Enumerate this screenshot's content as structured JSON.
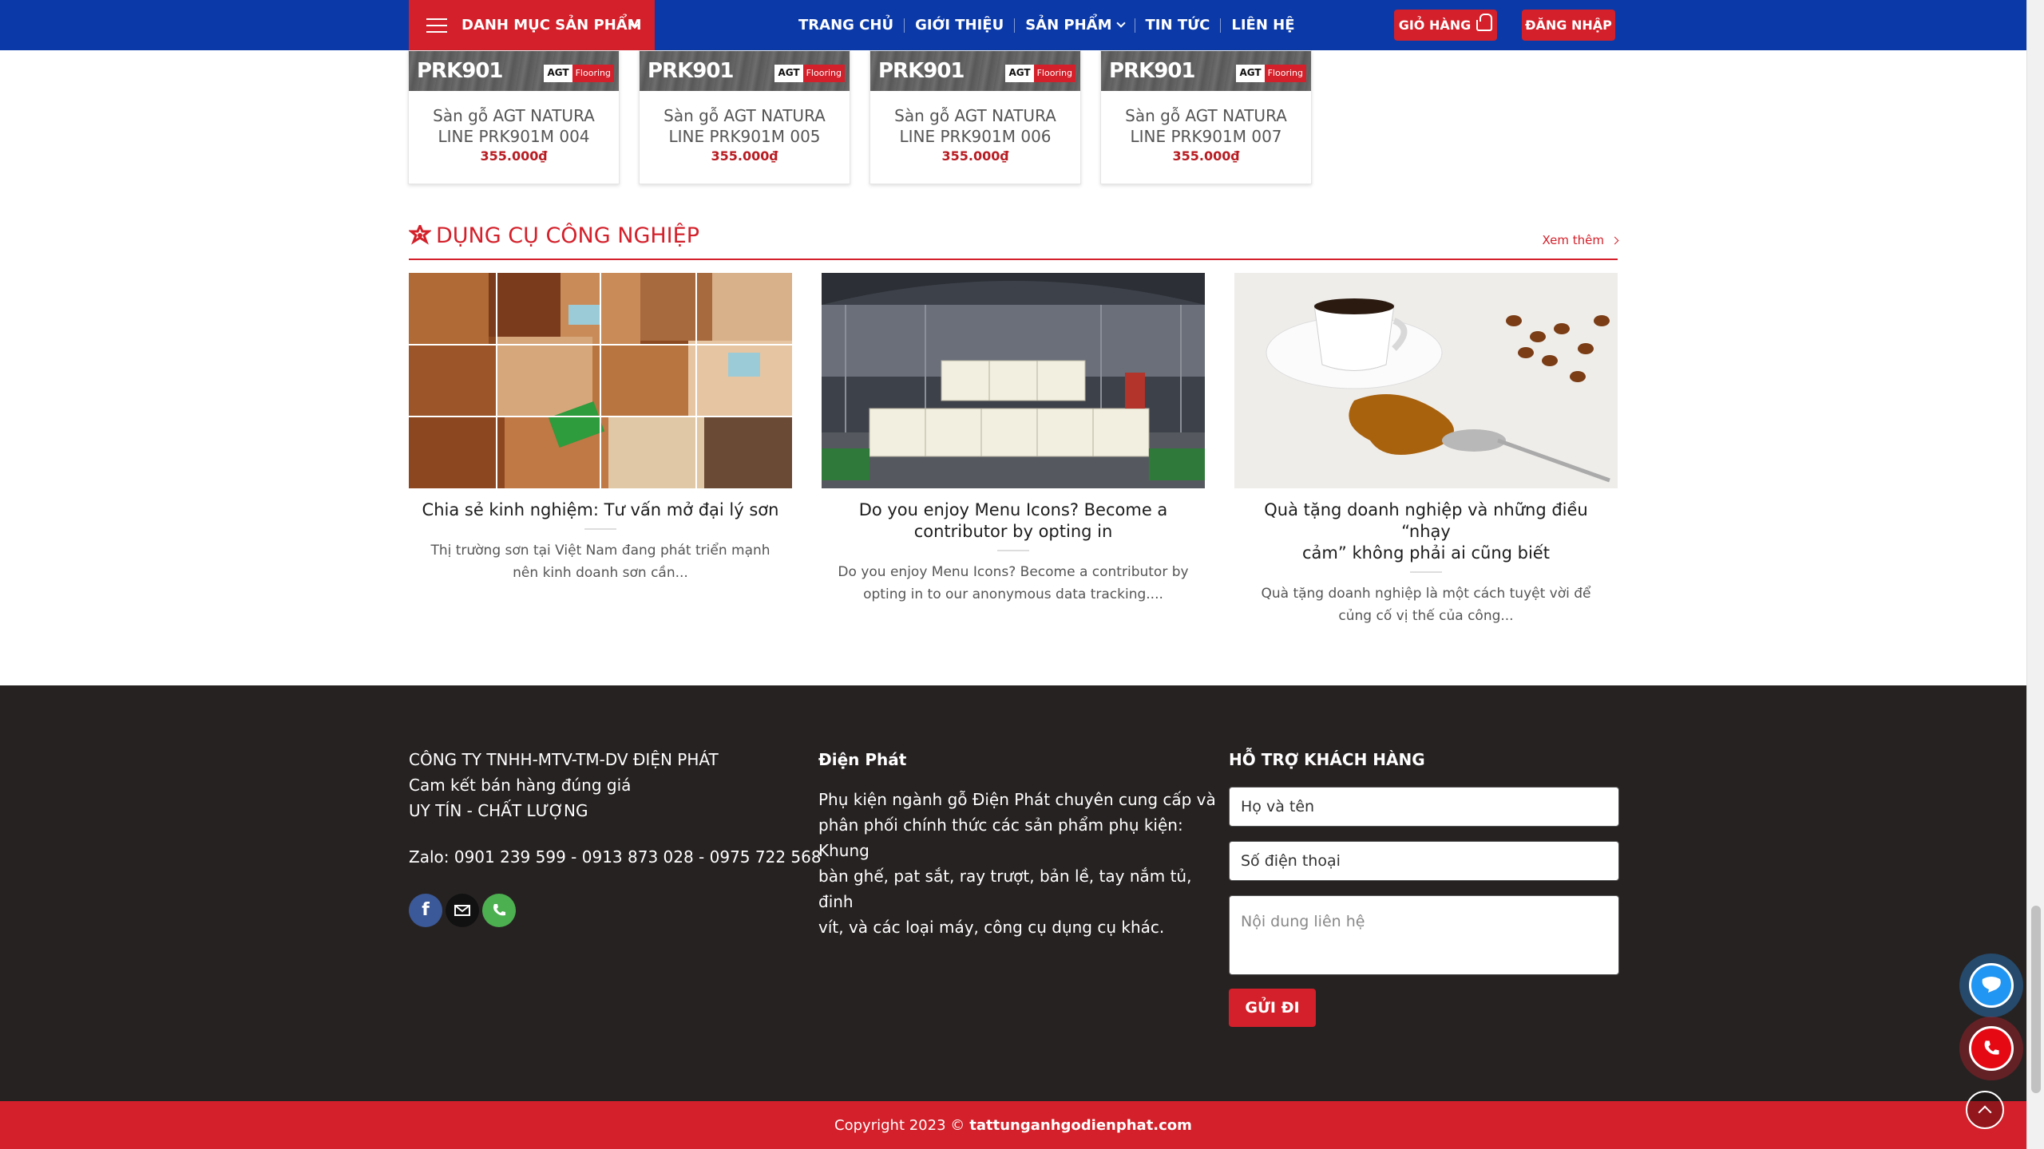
{
  "header": {
    "category_menu": "DANH MỤC SẢN PHẨM",
    "nav": [
      "TRANG CHỦ",
      "GIỚI THIỆU",
      "SẢN PHẨM",
      "TIN TỨC",
      "LIÊN HỆ"
    ],
    "cart_label": "GIỎ HÀNG",
    "login_label": "ĐĂNG NHẬP"
  },
  "products": [
    {
      "code": "PRK901",
      "brand": "AGT",
      "brand_tag": "Flooring",
      "name_line1": "Sàn gỗ AGT NATURA",
      "name_line2": "LINE PRK901M 004",
      "price": "355.000₫"
    },
    {
      "code": "PRK901",
      "brand": "AGT",
      "brand_tag": "Flooring",
      "name_line1": "Sàn gỗ AGT NATURA",
      "name_line2": "LINE PRK901M 005",
      "price": "355.000₫"
    },
    {
      "code": "PRK901",
      "brand": "AGT",
      "brand_tag": "Flooring",
      "name_line1": "Sàn gỗ AGT NATURA",
      "name_line2": "LINE PRK901M 006",
      "price": "355.000₫"
    },
    {
      "code": "PRK901",
      "brand": "AGT",
      "brand_tag": "Flooring",
      "name_line1": "Sàn gỗ AGT NATURA",
      "name_line2": "LINE PRK901M 007",
      "price": "355.000₫"
    }
  ],
  "section": {
    "title": "DỤNG CỤ CÔNG NGHIỆP",
    "more_label": "Xem thêm"
  },
  "posts": [
    {
      "title_line1": "Chia sẻ kinh nghiệm: Tư vấn mở đại lý sơn",
      "title_line2": "",
      "excerpt_line1": "Thị trường sơn tại Việt Nam đang phát triển mạnh",
      "excerpt_line2": "nên kinh doanh sơn cần..."
    },
    {
      "title_line1": "Do you enjoy Menu Icons? Become a",
      "title_line2": "contributor by opting in",
      "excerpt_line1": "Do you enjoy Menu Icons? Become a contributor by",
      "excerpt_line2": "opting in to our anonymous data tracking...."
    },
    {
      "title_line1": "Quà tặng doanh nghiệp và những điều “nhạy",
      "title_line2": "cảm” không phải ai cũng biết",
      "excerpt_line1": "Quà tặng doanh nghiệp là một cách tuyệt vời để",
      "excerpt_line2": "củng cố vị thế của công..."
    }
  ],
  "footer": {
    "company": {
      "line1": "CÔNG TY TNHH-MTV-TM-DV ĐIỆN PHÁT",
      "line2": "Cam kết bán hàng đúng giá",
      "line3": "UY TÍN - CHẤT LƯỢNG",
      "zalo": "Zalo: 0901 239 599 - 0913 873 028 - 0975 722 568"
    },
    "about": {
      "title": "Điện Phát",
      "line1": "Phụ kiện ngành gỗ Điện Phát chuyên cung cấp và",
      "line2": "phân phối chính thức các sản phẩm phụ kiện: Khung",
      "line3": "bàn ghế, pat sắt, ray trượt, bản lề, tay nắm tủ, đinh",
      "line4": "vít, và các loại máy, công cụ dụng cụ khác."
    },
    "support": {
      "title": "HỖ TRỢ KHÁCH HÀNG",
      "name_value": "Họ và tên",
      "phone_value": "Số điện thoại",
      "message_placeholder": "Nội dung liên hệ",
      "send_label": "GỬI ĐI"
    }
  },
  "copyright": {
    "prefix": "Copyright 2023 ©",
    "site": "tattunganhgodienphat.com"
  },
  "colors": {
    "primary_blue": "#0b3aa8",
    "accent_red": "#d3202a",
    "footer_bg": "#272222"
  }
}
